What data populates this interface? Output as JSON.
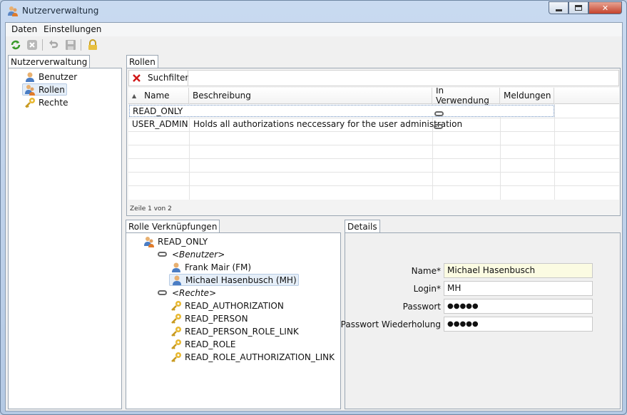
{
  "window": {
    "title": "Nutzerverwaltung",
    "close_glyph": "✕"
  },
  "menu": {
    "items": [
      "Daten",
      "Einstellungen"
    ]
  },
  "toolbar": {
    "icons": [
      "refresh-icon",
      "cancel-icon",
      "undo-icon",
      "save-icon",
      "lock-icon"
    ]
  },
  "nav": {
    "tab_label": "Nutzerverwaltung",
    "items": [
      {
        "label": "Benutzer",
        "icon": "user-icon"
      },
      {
        "label": "Rollen",
        "icon": "role-icon",
        "selected": true
      },
      {
        "label": "Rechte",
        "icon": "key-icon"
      }
    ]
  },
  "roles": {
    "tab_label": "Rollen",
    "search_label": "Suchfilter",
    "search_value": "",
    "sort_glyph": "▲",
    "columns": [
      "Name",
      "Beschreibung",
      "In Verwendung",
      "Meldungen"
    ],
    "rows": [
      {
        "name": "READ_ONLY",
        "description": "",
        "in_use": true,
        "messages": ""
      },
      {
        "name": "USER_ADMIN",
        "description": "Holds all authorizations neccessary for the user administration",
        "in_use": true,
        "messages": ""
      }
    ],
    "status": "Zeile 1 von 2"
  },
  "links": {
    "tab_label": "Rolle Verknüpfungen",
    "root": "READ_ONLY",
    "users_group": "<Benutzer>",
    "users": [
      "Frank Mair (FM)",
      "Michael Hasenbusch (MH)"
    ],
    "rights_group": "<Rechte>",
    "rights": [
      "READ_AUTHORIZATION",
      "READ_PERSON",
      "READ_PERSON_ROLE_LINK",
      "READ_ROLE",
      "READ_ROLE_AUTHORIZATION_LINK"
    ]
  },
  "details": {
    "tab_label": "Details",
    "fields": [
      {
        "label": "Name*",
        "value": "Michael Hasenbusch",
        "highlight": "#fbfbe2"
      },
      {
        "label": "Login*",
        "value": "MH"
      },
      {
        "label": "Passwort",
        "value": "●●●●●"
      },
      {
        "label": "Passwort Wiederholung",
        "value": "●●●●●"
      }
    ]
  },
  "colors": {
    "selection_border": "#6b8fc0",
    "search_clear": "#d01515"
  }
}
